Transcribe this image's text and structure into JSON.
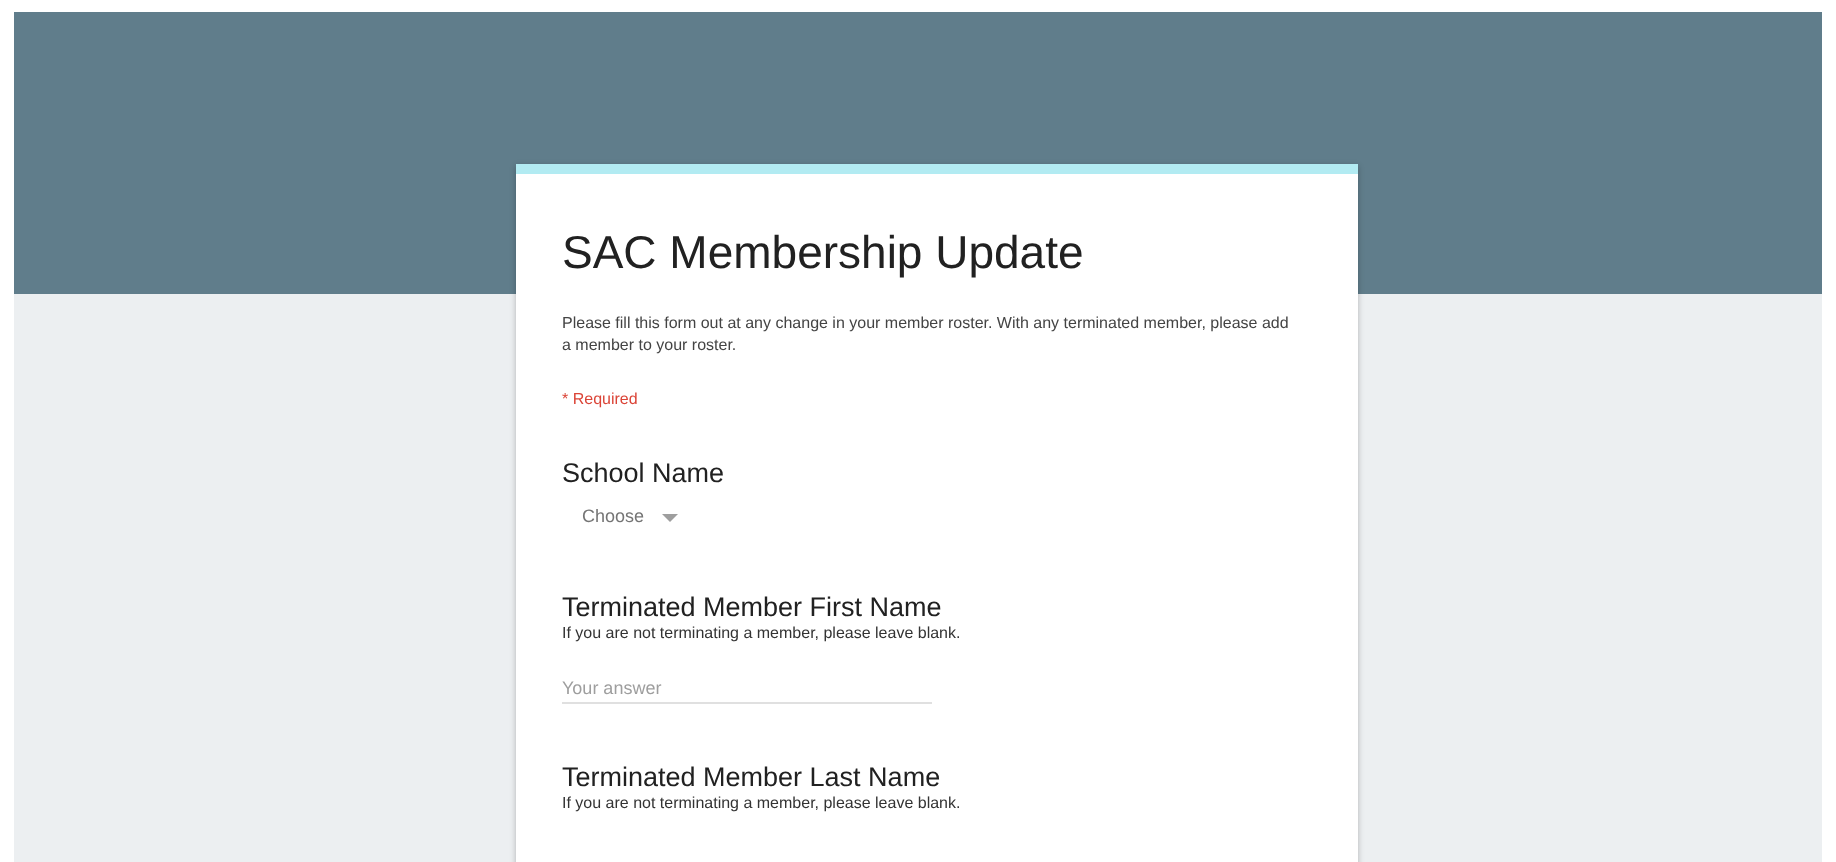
{
  "form": {
    "title": "SAC Membership Update",
    "description": "Please fill this form out at any change in your member roster.  With any terminated member, please add a member to your roster.",
    "required_note": "* Required"
  },
  "questions": [
    {
      "kind": "dropdown",
      "title": "School Name",
      "placeholder": "Choose"
    },
    {
      "kind": "text",
      "title": "Terminated Member First Name",
      "help": "If you are not terminating a member, please leave blank.",
      "placeholder": "Your answer"
    },
    {
      "kind": "text",
      "title": "Terminated Member Last Name",
      "help": "If you are not terminating a member, please leave blank."
    }
  ]
}
